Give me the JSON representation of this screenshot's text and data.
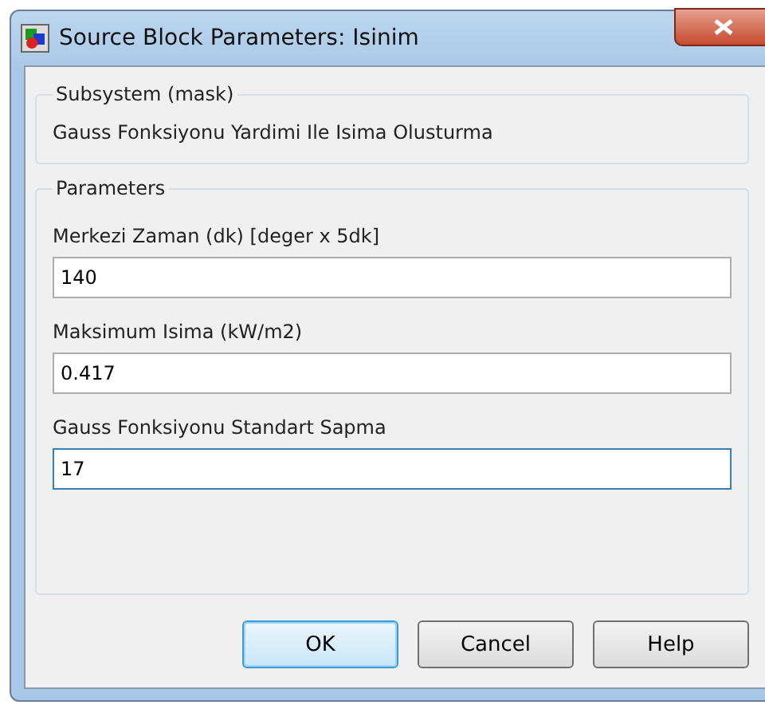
{
  "window": {
    "title": "Source Block Parameters: Isinim"
  },
  "description": {
    "title": "Subsystem (mask)",
    "text": "Gauss Fonksiyonu Yardimi Ile Isima Olusturma"
  },
  "parameters": {
    "title": "Parameters",
    "fields": [
      {
        "label": "Merkezi Zaman (dk) [deger x 5dk]",
        "value": "140",
        "focused": false
      },
      {
        "label": "Maksimum Isima (kW/m2)",
        "value": "0.417",
        "focused": false
      },
      {
        "label": "Gauss Fonksiyonu Standart Sapma",
        "value": "17",
        "focused": true
      }
    ]
  },
  "buttons": [
    {
      "label": "OK",
      "default": true
    },
    {
      "label": "Cancel",
      "default": false
    },
    {
      "label": "Help",
      "default": false
    }
  ]
}
